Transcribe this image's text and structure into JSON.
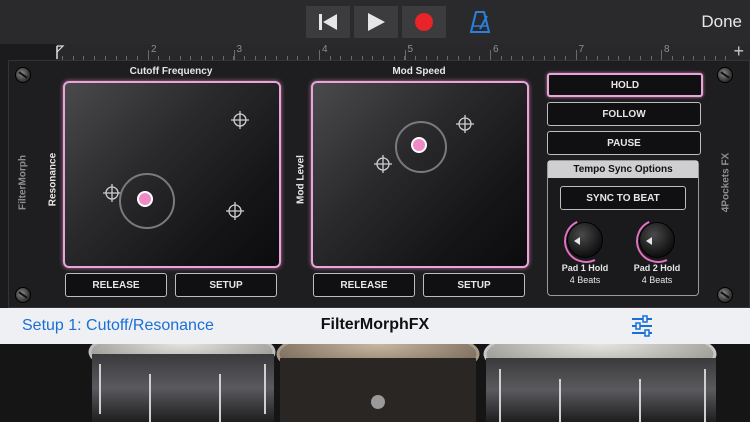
{
  "topbar": {
    "rewind_icon": "rewind-to-start-icon",
    "play_icon": "play-icon",
    "record_icon": "record-icon",
    "metronome_icon": "metronome-icon",
    "done_label": "Done"
  },
  "ruler": {
    "marks": [
      "2",
      "3",
      "4",
      "5",
      "6",
      "7",
      "8"
    ],
    "add_icon": "plus-icon"
  },
  "plugin": {
    "left_side_label": "FilterMorph",
    "right_side_label": "4Pockets FX",
    "pad1": {
      "title": "Cutoff Frequency",
      "y_label": "Resonance",
      "release_label": "RELEASE",
      "setup_label": "SETUP"
    },
    "pad2": {
      "title": "Mod Speed",
      "y_label": "Mod Level",
      "release_label": "RELEASE",
      "setup_label": "SETUP"
    },
    "controls": {
      "hold_label": "HOLD",
      "follow_label": "FOLLOW",
      "pause_label": "PAUSE",
      "active": "HOLD"
    },
    "tempo": {
      "title": "Tempo Sync Options",
      "sync_label": "SYNC TO BEAT",
      "knob1_label": "Pad 1 Hold",
      "knob1_value": "4 Beats",
      "knob2_label": "Pad 2 Hold",
      "knob2_value": "4 Beats"
    }
  },
  "statusbar": {
    "setup_text": "Setup 1: Cutoff/Resonance",
    "title": "FilterMorphFX",
    "mixer_icon": "mixer-sliders-icon"
  },
  "colors": {
    "accent_pink": "#e8a6d8",
    "link_blue": "#1a6fd6",
    "record_red": "#e8232a",
    "metronome_blue": "#2a7fe0"
  }
}
